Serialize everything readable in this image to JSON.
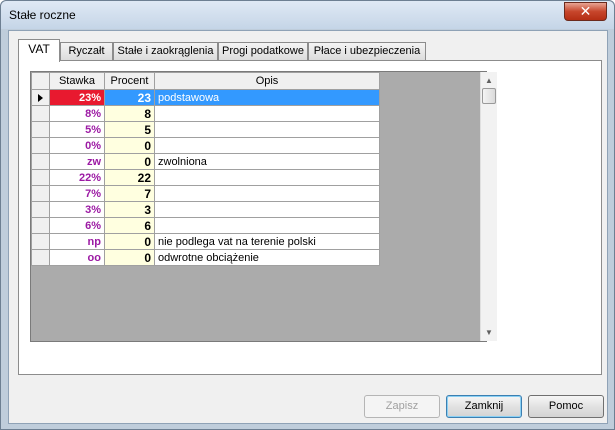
{
  "window": {
    "title": "Stałe roczne",
    "close_glyph": "✕"
  },
  "tabs": [
    {
      "label": "VAT",
      "active": true
    },
    {
      "label": "Ryczałt",
      "active": false
    },
    {
      "label": "Stałe i zaokrąglenia",
      "active": false
    },
    {
      "label": "Progi podatkowe",
      "active": false
    },
    {
      "label": "Płace i ubezpieczenia",
      "active": false
    }
  ],
  "grid": {
    "columns": {
      "stawka": "Stawka",
      "procent": "Procent",
      "opis": "Opis"
    },
    "selected_row": 0,
    "rows": [
      {
        "stawka": "23%",
        "procent": "23",
        "opis": "podstawowa"
      },
      {
        "stawka": "8%",
        "procent": "8",
        "opis": ""
      },
      {
        "stawka": "5%",
        "procent": "5",
        "opis": ""
      },
      {
        "stawka": "0%",
        "procent": "0",
        "opis": ""
      },
      {
        "stawka": "zw",
        "procent": "0",
        "opis": "zwolniona"
      },
      {
        "stawka": "22%",
        "procent": "22",
        "opis": ""
      },
      {
        "stawka": "7%",
        "procent": "7",
        "opis": ""
      },
      {
        "stawka": "3%",
        "procent": "3",
        "opis": ""
      },
      {
        "stawka": "6%",
        "procent": "6",
        "opis": ""
      },
      {
        "stawka": "np",
        "procent": "0",
        "opis": "nie podlega vat na terenie polski"
      },
      {
        "stawka": "oo",
        "procent": "0",
        "opis": "odwrotne obciążenie"
      }
    ]
  },
  "buttons": {
    "zapisz": "Zapisz",
    "zamknij": "Zamknij",
    "pomoc": "Pomoc"
  },
  "colors": {
    "stawka_text": "#9c1aa4",
    "selection": "#3399ff",
    "selected_stawka": "#e8192f",
    "procent_bg": "#ffffe0"
  }
}
